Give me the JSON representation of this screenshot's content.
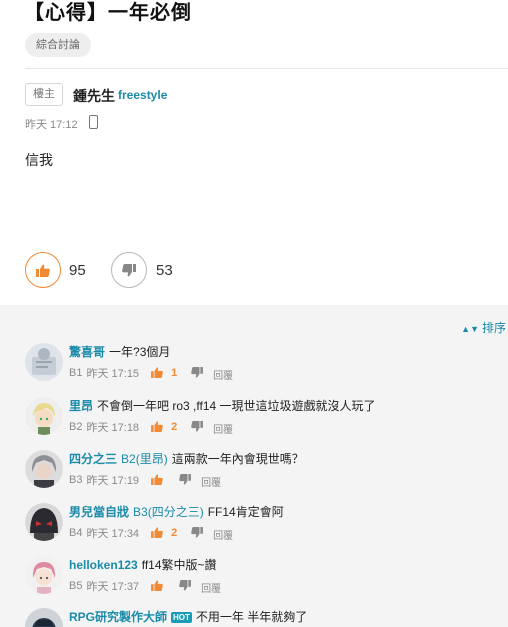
{
  "post": {
    "title": "【心得】一年必倒",
    "board_tag": "綜合討論",
    "role_badge": "樓主",
    "author_name": "鍾先生",
    "author_id": "freestyle",
    "time": "昨天 17:12",
    "body": "信我",
    "upvotes": "95",
    "downvotes": "53"
  },
  "sort_label": "排序",
  "colors": {
    "accent_link": "#1a8ba8",
    "upvote": "#f08a35",
    "comments_bg": "#f4f4f4"
  },
  "comments": [
    {
      "user": "驚喜哥",
      "reply_to": "",
      "hot": "",
      "text": "一年?3個月",
      "floor": "B1",
      "time": "昨天 17:15",
      "likes": "1",
      "reply_label": "回覆",
      "avatar": "avatar-generic-icon"
    },
    {
      "user": "里昂",
      "reply_to": "",
      "hot": "",
      "text": "不會倒一年吧 ro3 ,ff14 一現世這垃圾遊戲就沒人玩了",
      "floor": "B2",
      "time": "昨天 17:18",
      "likes": "2",
      "reply_label": "回覆",
      "avatar": "avatar-blonde-icon"
    },
    {
      "user": "四分之三",
      "reply_to": "B2(里昂)",
      "hot": "",
      "text": "這兩款一年內會現世嗎？",
      "floor": "B3",
      "time": "昨天 17:19",
      "likes": "",
      "reply_label": "回覆",
      "avatar": "avatar-silver-hair-icon"
    },
    {
      "user": "男兒當自戕",
      "reply_to": "B3(四分之三)",
      "hot": "",
      "text": "FF14肯定會阿",
      "floor": "B4",
      "time": "昨天 17:34",
      "likes": "2",
      "reply_label": "回覆",
      "avatar": "avatar-dark-helmet-icon"
    },
    {
      "user": "helloken123",
      "reply_to": "",
      "hot": "",
      "text": "ff14繁中版~讚",
      "floor": "B5",
      "time": "昨天 17:37",
      "likes": "",
      "reply_label": "回覆",
      "avatar": "avatar-pink-hair-icon"
    },
    {
      "user": "RPG研究製作大師",
      "reply_to": "",
      "hot": "HOT",
      "text": "不用一年 半年就夠了",
      "floor": "",
      "time": "",
      "likes": "",
      "reply_label": "",
      "avatar": "avatar-dark-icon"
    }
  ]
}
